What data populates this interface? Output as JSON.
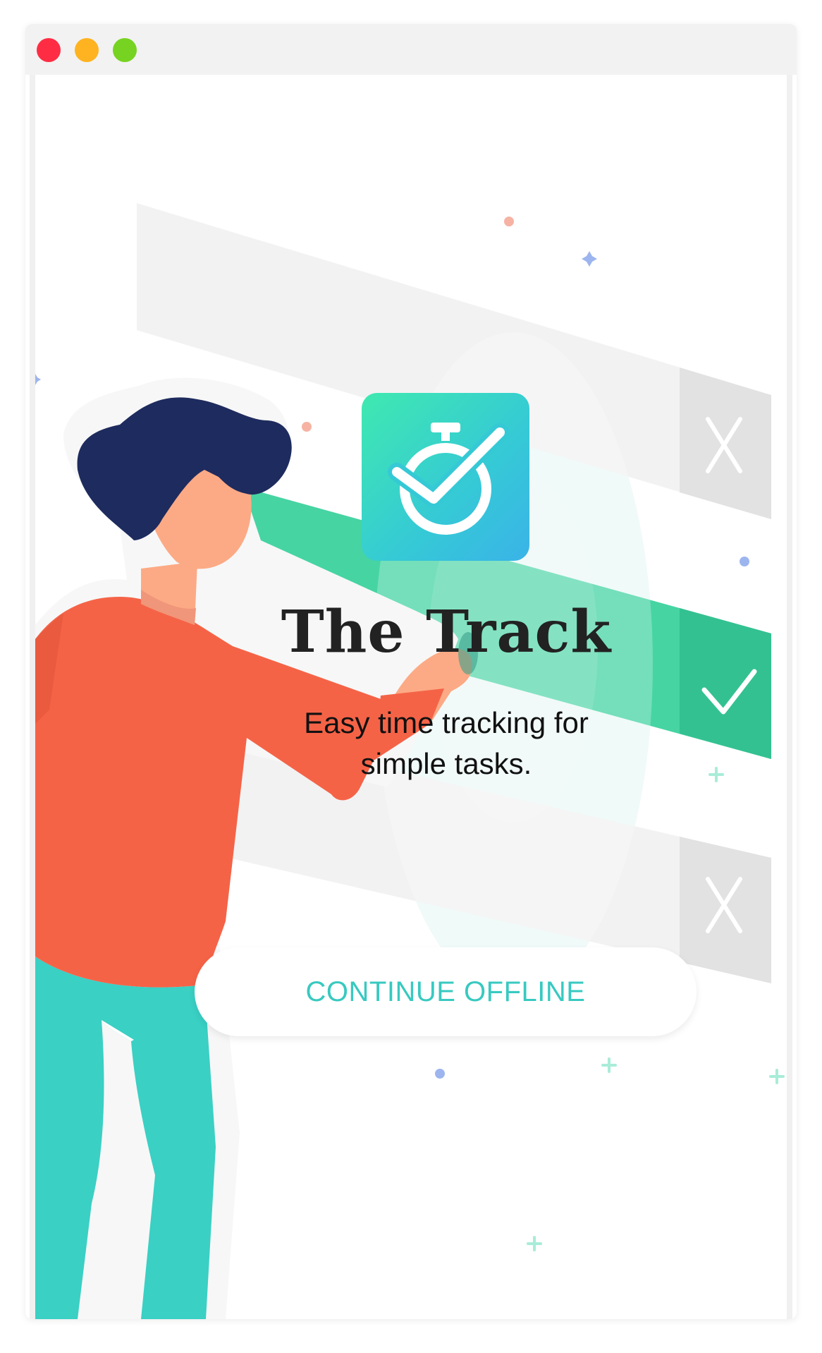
{
  "window": {
    "controls": {
      "close_color": "#ff2d44",
      "minimize_color": "#ffb321",
      "maximize_color": "#77d321"
    }
  },
  "app": {
    "icon": "stopwatch-check-icon",
    "icon_gradient": [
      "#3fe9b0",
      "#3ab3e8"
    ],
    "title": "The Track",
    "subtitle_line1": "Easy time tracking for",
    "subtitle_line2": "simple tasks.",
    "cta_label": "CONTINUE OFFLINE",
    "accent_color": "#38c9c0"
  },
  "illustration": {
    "rows": [
      {
        "state": "cancelled",
        "icon": "x-mark-icon"
      },
      {
        "state": "done",
        "icon": "check-mark-icon",
        "color": "#3ecf9c"
      },
      {
        "state": "cancelled",
        "icon": "x-mark-icon"
      }
    ],
    "person": {
      "hair_color": "#1e2b5e",
      "shirt_color": "#f56347",
      "pants_color": "#3ad0c4",
      "skin_color": "#fcaa85"
    }
  }
}
